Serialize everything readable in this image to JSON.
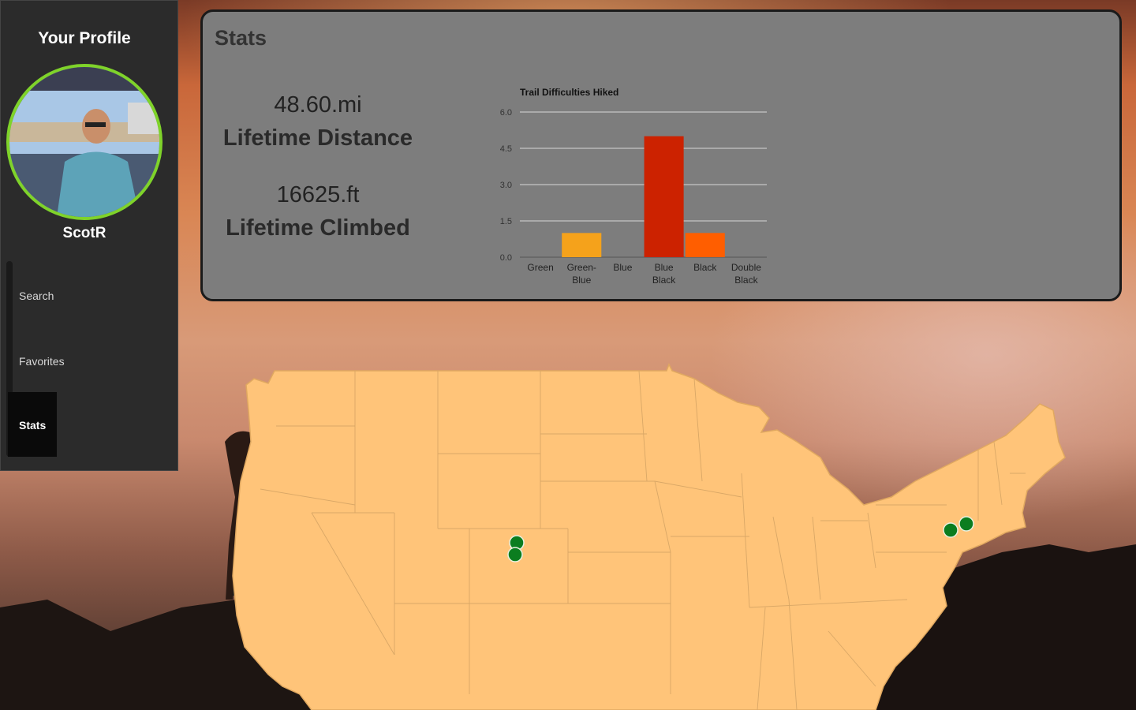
{
  "sidebar": {
    "title": "Your Profile",
    "username": "ScotR",
    "nav": [
      {
        "label": "Search",
        "active": false
      },
      {
        "label": "Favorites",
        "active": false
      },
      {
        "label": "Stats",
        "active": true
      }
    ],
    "accent_color": "#7fd32a"
  },
  "stats": {
    "title": "Stats",
    "distance_value": "48.60.mi",
    "distance_label": "Lifetime Distance",
    "climbed_value": "16625.ft",
    "climbed_label": "Lifetime Climbed"
  },
  "chart_data": {
    "type": "bar",
    "title": "Trail Difficulties Hiked",
    "categories": [
      [
        "Green"
      ],
      [
        "Green-",
        "Blue"
      ],
      [
        "Blue"
      ],
      [
        "Blue",
        "Black"
      ],
      [
        "Black"
      ],
      [
        "Double",
        "Black"
      ]
    ],
    "values": [
      0,
      1,
      0,
      5,
      1,
      0
    ],
    "colors": [
      "#2e8b57",
      "#f5a21b",
      "#3b6fd8",
      "#cc2200",
      "#ff5e00",
      "#111111"
    ],
    "ylim": [
      0,
      6
    ],
    "yticks": [
      "0.0",
      "1.5",
      "3.0",
      "4.5",
      "6.0"
    ],
    "grid": true
  },
  "map": {
    "fill_color": "#ffc479",
    "marker_color": "#0b7d1f",
    "markers": [
      {
        "region": "Colorado"
      },
      {
        "region": "Colorado"
      },
      {
        "region": "Pennsylvania"
      },
      {
        "region": "New Jersey"
      }
    ]
  }
}
